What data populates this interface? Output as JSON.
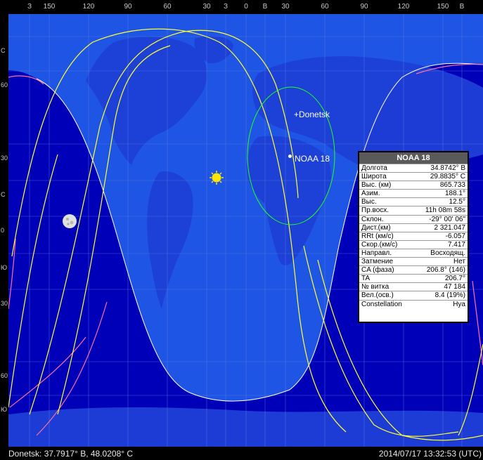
{
  "top_axis": [
    "З",
    "150",
    "120",
    "90",
    "60",
    "30",
    "З",
    "0",
    "В",
    "30",
    "60",
    "90",
    "120",
    "150",
    "В"
  ],
  "left_axis": [
    "С",
    "60",
    "30",
    "С",
    "0",
    "Ю",
    "30",
    "60",
    "Ю"
  ],
  "city": {
    "label": "+Donetsk"
  },
  "satellite": {
    "label": "NOAA 18"
  },
  "colors": {
    "ocean": "#0000b8",
    "land": "#1d3fd6",
    "day_ocean": "#1f55e4",
    "orbit_yellow": "#ffff33",
    "orbit_pink": "#ff6fa0",
    "footprint": "#22ff22"
  },
  "panel": {
    "title": "NOAA 18",
    "rows": [
      {
        "label": "Долгота",
        "value": "34.8742° В"
      },
      {
        "label": "Широта",
        "value": "29.8835° С"
      },
      {
        "label": "Выс. (км)",
        "value": "865.733"
      },
      {
        "label": "Азим.",
        "value": "188.1°"
      },
      {
        "label": "Выс.",
        "value": "12.5°"
      },
      {
        "label": "Пр.восх.",
        "value": "11h 08m 58s"
      },
      {
        "label": "Склон.",
        "value": "-29° 00' 06\""
      },
      {
        "label": "Дист.(км)",
        "value": "2 321.047"
      },
      {
        "label": "RRt (км/с)",
        "value": "-6.057"
      },
      {
        "label": "Скор.(км/с)",
        "value": "7.417"
      },
      {
        "label": "Направл.",
        "value": "Восходящ."
      },
      {
        "label": "Затмение",
        "value": "Нет"
      },
      {
        "label": "CA (фаза)",
        "value": "206.8° (146)"
      },
      {
        "label": "TA",
        "value": "206.7°"
      },
      {
        "label": "№ витка",
        "value": "47 184"
      },
      {
        "label": "Вел.(осв.)",
        "value": "8.4 (19%)"
      },
      {
        "label": "Constellation",
        "value": "Hya"
      }
    ]
  },
  "status": {
    "location": "Donetsk: 37.7917° В, 48.0208° С",
    "datetime": "2014/07/17 13:32:53 (UTC)"
  }
}
